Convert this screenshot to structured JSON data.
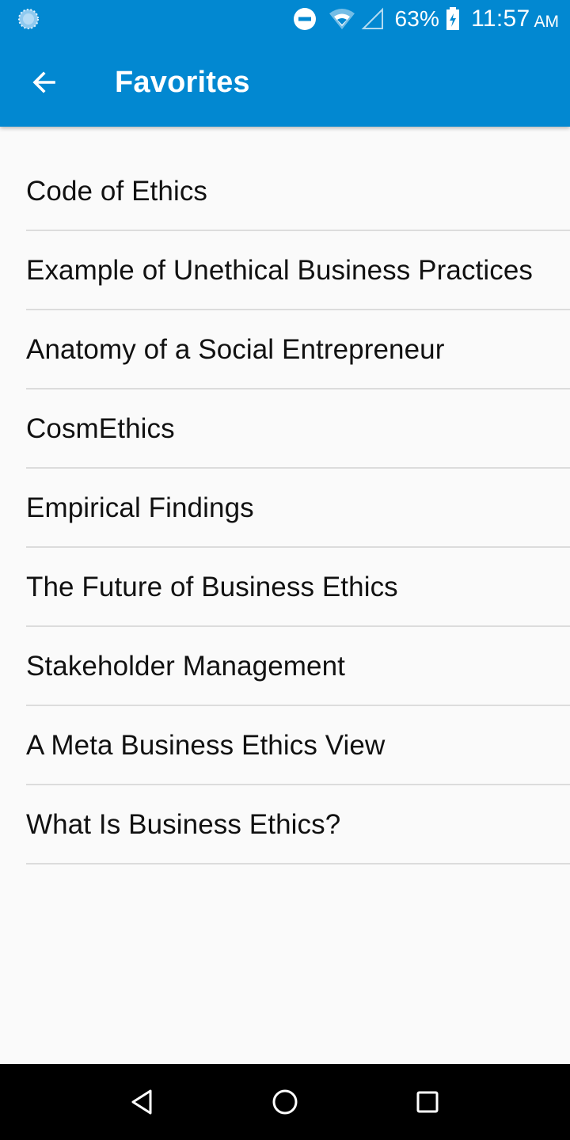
{
  "status_bar": {
    "battery_percent": "63%",
    "time": "11:57",
    "ampm": "AM",
    "icons": [
      "loading-icon",
      "do-not-disturb-icon",
      "wifi-icon",
      "signal-icon",
      "battery-charging-icon"
    ]
  },
  "toolbar": {
    "title": "Favorites",
    "back_icon": "arrow-left-icon"
  },
  "favorites": {
    "items": [
      {
        "label": "Code of Ethics"
      },
      {
        "label": "Example of Unethical Business Practices"
      },
      {
        "label": "Anatomy of a Social Entrepreneur"
      },
      {
        "label": "CosmEthics"
      },
      {
        "label": "Empirical Findings"
      },
      {
        "label": "The Future of Business Ethics"
      },
      {
        "label": "Stakeholder Management"
      },
      {
        "label": "A Meta Business Ethics View"
      },
      {
        "label": "What Is Business Ethics?"
      }
    ]
  },
  "nav_bar": {
    "icons": [
      "nav-back-icon",
      "nav-home-icon",
      "nav-recents-icon"
    ]
  },
  "colors": {
    "app_bar": "#0288d1",
    "background": "#fafafa",
    "divider": "#dcdcdc",
    "nav_bar": "#000000",
    "text": "#111111"
  }
}
